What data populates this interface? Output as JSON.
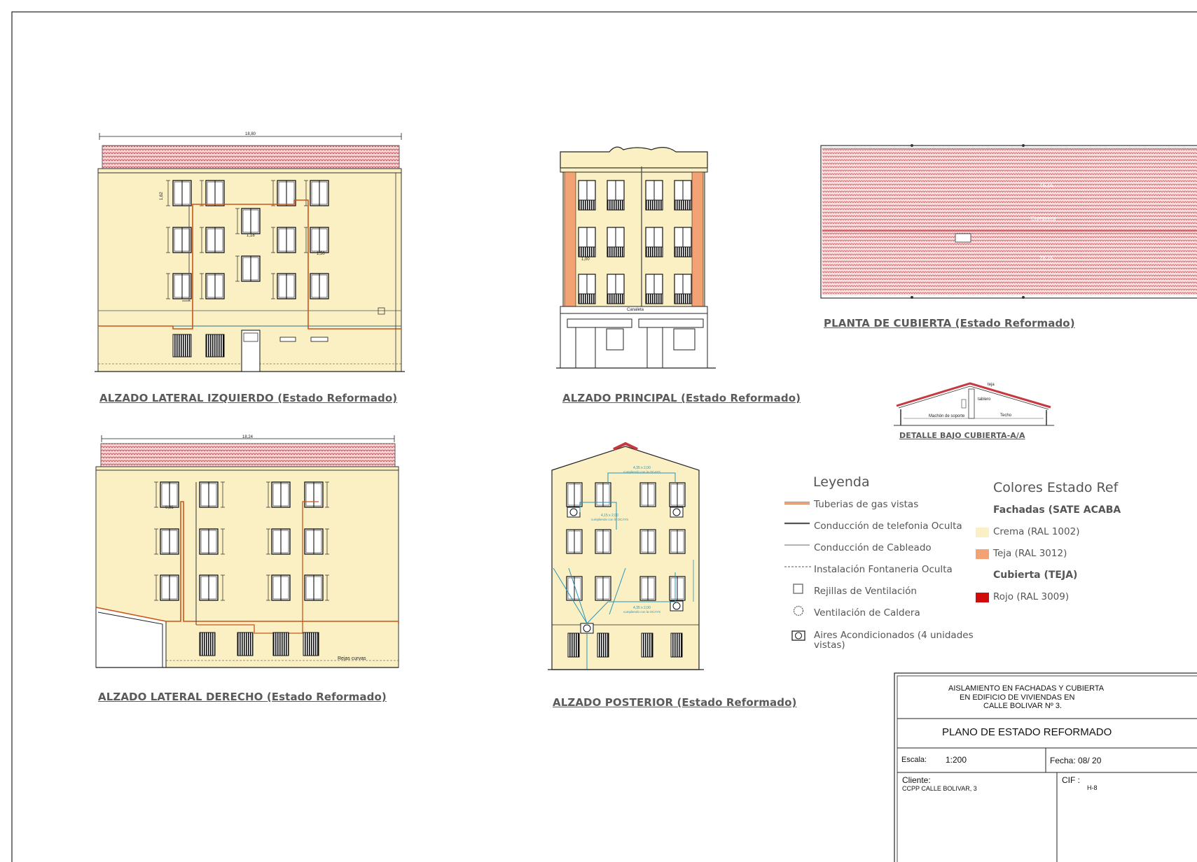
{
  "drawing_titles": {
    "left_elevation": {
      "main": "ALZADO LATERAL IZQUIERDO",
      "status": "(Estado Reformado)"
    },
    "main_elevation": {
      "main": "ALZADO PRINCIPAL",
      "status": "(Estado Reformado)"
    },
    "roof_plan": {
      "main": "PLANTA DE CUBIERTA",
      "status": "(Estado Reformado)"
    },
    "roof_detail": "DETALLE BAJO CUBIERTA-A/A",
    "right_elevation": {
      "main": "ALZADO LATERAL DERECHO",
      "status": "(Estado Reformado)"
    },
    "rear_elevation": {
      "main": "ALZADO POSTERIOR",
      "status": "(Estado Reformado)"
    }
  },
  "annotations": {
    "left_total_width": "18,80",
    "right_total_width": "18,24",
    "main_canaleta": "Canaleta",
    "roof_teja_top": "TEJA",
    "roof_cumbrera": "Cumbrera",
    "roof_teja_bottom": "TEJA",
    "detail_teja": "teja",
    "detail_tablero": "tablero",
    "detail_techo": "Techo",
    "detail_soporte": "Machón de soporte",
    "right_rejas": "Rejas curvas",
    "rear_ac_1": "4,35 x 2,00",
    "rear_ac_1b": "cumpliendo con la OCAYS",
    "rear_ac_2": "4,15 x 2,00",
    "rear_ac_2b": "cumpliendo con la OCAYS",
    "rear_ac_3": "4,35 x 2,00",
    "rear_ac_3b": "cumpliendo con la OCAYS",
    "dim_162": "1,62",
    "dim_118": "1,18",
    "dim_150": "1,50",
    "dim_100": "1,00",
    "dim_085": "0,85"
  },
  "legend": {
    "heading": "Leyenda",
    "items": [
      {
        "label": "Tuberias de gas vistas",
        "icon": "gas-pipe-line-icon"
      },
      {
        "label": "Conducción de telefonia Oculta",
        "icon": "phone-line-icon"
      },
      {
        "label": "Conducción de Cableado",
        "icon": "cable-line-icon"
      },
      {
        "label": "Instalación Fontaneria Oculta",
        "icon": "plumbing-dashed-line-icon"
      },
      {
        "label": "Rejillas de Ventilación",
        "icon": "vent-grille-square-icon"
      },
      {
        "label": "Ventilación de Caldera",
        "icon": "boiler-vent-circle-icon"
      },
      {
        "label": "Aires Acondicionados (4 unidades",
        "label2": "vistas)",
        "icon": "air-conditioner-icon"
      }
    ]
  },
  "colors_panel": {
    "heading": "Colores Estado Ref",
    "facades_heading": "Fachadas (SATE ACABA",
    "roof_heading": "Cubierta (TEJA)",
    "swatches": [
      {
        "label": "Crema (RAL 1002)",
        "color": "#fbf0c3"
      },
      {
        "label": "Teja (RAL 3012)",
        "color": "#f3a273"
      },
      {
        "label": "Rojo (RAL 3009)",
        "color": "#d10a0a"
      }
    ]
  },
  "title_block": {
    "project_line1": "AISLAMIENTO EN FACHADAS Y CUBIERTA",
    "project_line2": "EN  EDIFICIO  DE  VIVIENDAS  EN",
    "project_line3": "CALLE  BOLIVAR  Nº 3.",
    "plan_name": "PLANO DE ESTADO REFORMADO",
    "scale_label": "Escala:",
    "scale_value": "1:200",
    "date_label": "Fecha: 08/ 20",
    "client_label": "Cliente:",
    "client_value": "CCPP CALLE BOLIVAR, 3",
    "cif_label": "CIF :",
    "cif_value": "H-8"
  },
  "palette": {
    "cream": "#fbf0c3",
    "terracotta": "#f3a273",
    "roof_red": "#c7373f",
    "gas_orange": "#c8561a",
    "ac_cyan": "#2a93b8",
    "line": "#333333"
  }
}
